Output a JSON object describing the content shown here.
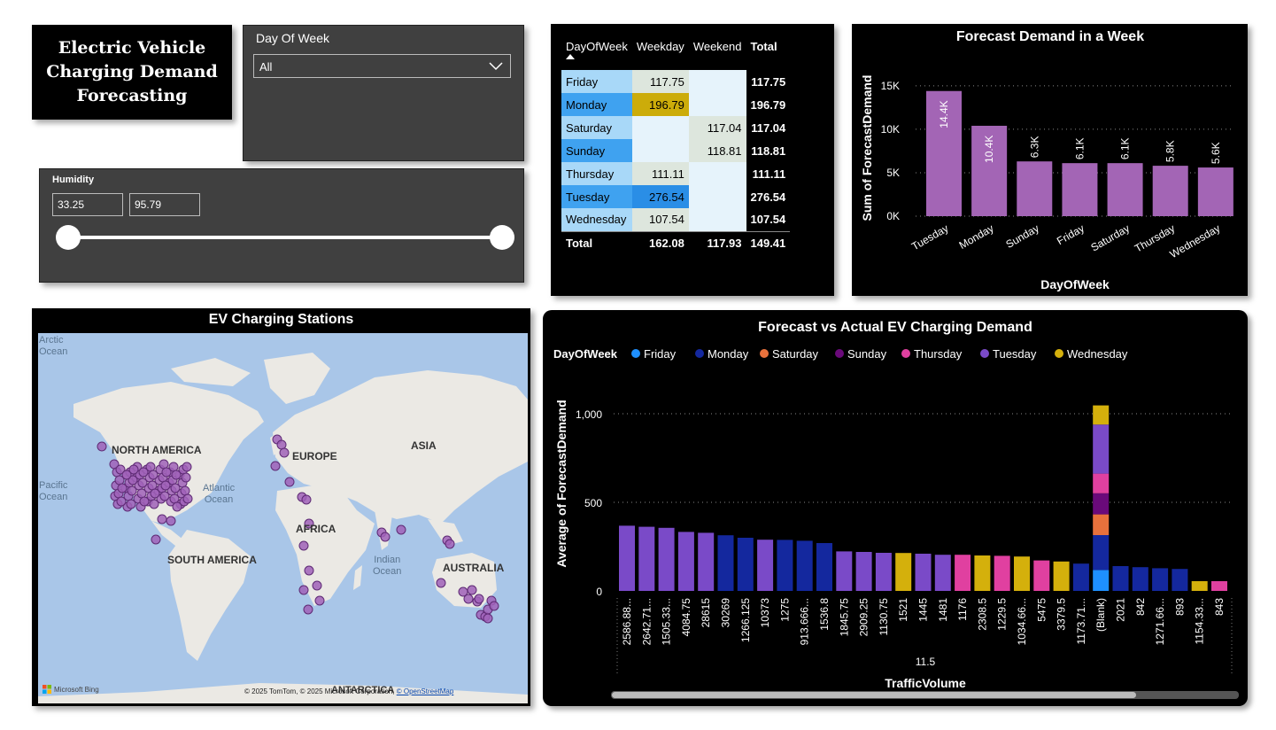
{
  "title": {
    "text": "Electric Vehicle\nCharging Demand\nForecasting"
  },
  "day_slicer": {
    "label": "Day Of Week",
    "value": "All"
  },
  "humidity_slicer": {
    "label": "Humidity",
    "min": "33.25",
    "max": "95.79"
  },
  "matrix": {
    "headers": [
      "DayOfWeek",
      "Weekday",
      "Weekend",
      "Total"
    ],
    "rows": [
      {
        "day": "Friday",
        "weekday": "117.75",
        "weekend": "",
        "total": "117.75"
      },
      {
        "day": "Monday",
        "weekday": "196.79",
        "weekend": "",
        "total": "196.79"
      },
      {
        "day": "Saturday",
        "weekday": "",
        "weekend": "117.04",
        "total": "117.04"
      },
      {
        "day": "Sunday",
        "weekday": "",
        "weekend": "118.81",
        "total": "118.81"
      },
      {
        "day": "Thursday",
        "weekday": "111.11",
        "weekend": "",
        "total": "111.11"
      },
      {
        "day": "Tuesday",
        "weekday": "276.54",
        "weekend": "",
        "total": "276.54"
      },
      {
        "day": "Wednesday",
        "weekday": "107.54",
        "weekend": "",
        "total": "107.54"
      }
    ],
    "total_row": {
      "label": "Total",
      "weekday": "162.08",
      "weekend": "117.93",
      "total": "149.41"
    },
    "colors": {
      "header_bg": "#000000",
      "day_light": "#a8d8f8",
      "day_dark": "#3fa2f0",
      "cell_bg": "#e6f3fb",
      "cell_neutral": "#dde6dd",
      "monday_gold": "#ccac0a",
      "tuesday_blue": "#2a8ee6"
    }
  },
  "chart_data": [
    {
      "type": "bar",
      "title": "Forecast Demand in a Week",
      "xlabel": "DayOfWeek",
      "ylabel": "Sum of ForecastDemand",
      "categories": [
        "Tuesday",
        "Monday",
        "Sunday",
        "Friday",
        "Saturday",
        "Thursday",
        "Wednesday"
      ],
      "values": [
        14400,
        10400,
        6300,
        6100,
        6100,
        5800,
        5600
      ],
      "data_labels": [
        "14.4K",
        "10.4K",
        "6.3K",
        "6.1K",
        "6.1K",
        "5.8K",
        "5.6K"
      ],
      "yticks": [
        "0K",
        "5K",
        "10K",
        "15K"
      ],
      "ytick_values": [
        0,
        5000,
        10000,
        15000
      ],
      "ylim": [
        0,
        15800
      ],
      "grid": true,
      "color": "#a365b5"
    },
    {
      "type": "bar",
      "title": "Forecast vs Actual EV Charging Demand",
      "xlabel": "TrafficVolume",
      "ylabel": "Average of ForecastDemand",
      "group_label": "11.5",
      "legend_title": "DayOfWeek",
      "legend_position": "top-left",
      "series_legend": [
        {
          "name": "Friday",
          "color": "#1e90ff"
        },
        {
          "name": "Monday",
          "color": "#14289e"
        },
        {
          "name": "Saturday",
          "color": "#e8713c"
        },
        {
          "name": "Sunday",
          "color": "#6a0a7a"
        },
        {
          "name": "Thursday",
          "color": "#e040a0"
        },
        {
          "name": "Tuesday",
          "color": "#7a4ac8"
        },
        {
          "name": "Wednesday",
          "color": "#d4b00c"
        }
      ],
      "yticks": [
        "0",
        "500",
        "1,000"
      ],
      "ytick_values": [
        0,
        500,
        1000
      ],
      "ylim": [
        0,
        1050
      ],
      "grid": true,
      "categories": [
        "2586.88...",
        "2642.71...",
        "1505.33...",
        "4084.75",
        "28615",
        "30269",
        "1266.125",
        "10373",
        "1275",
        "913.666...",
        "1536.8",
        "1845.75",
        "2909.25",
        "1130.75",
        "1521",
        "1445",
        "1481",
        "1176",
        "2308.5",
        "1229.5",
        "1034.66...",
        "5475",
        "3379.5",
        "1173.71...",
        "(Blank)",
        "2021",
        "842",
        "1271.66...",
        "893",
        "1154.33...",
        "843"
      ],
      "points": [
        {
          "value": 368,
          "series": "Tuesday"
        },
        {
          "value": 362,
          "series": "Tuesday"
        },
        {
          "value": 356,
          "series": "Tuesday"
        },
        {
          "value": 333,
          "series": "Tuesday"
        },
        {
          "value": 328,
          "series": "Tuesday"
        },
        {
          "value": 314,
          "series": "Monday"
        },
        {
          "value": 300,
          "series": "Monday"
        },
        {
          "value": 289,
          "series": "Tuesday"
        },
        {
          "value": 288,
          "series": "Monday"
        },
        {
          "value": 283,
          "series": "Monday"
        },
        {
          "value": 270,
          "series": "Monday"
        },
        {
          "value": 223,
          "series": "Tuesday"
        },
        {
          "value": 220,
          "series": "Tuesday"
        },
        {
          "value": 215,
          "series": "Tuesday"
        },
        {
          "value": 214,
          "series": "Wednesday"
        },
        {
          "value": 210,
          "series": "Tuesday"
        },
        {
          "value": 204,
          "series": "Tuesday"
        },
        {
          "value": 204,
          "series": "Thursday"
        },
        {
          "value": 200,
          "series": "Wednesday"
        },
        {
          "value": 198,
          "series": "Thursday"
        },
        {
          "value": 194,
          "series": "Wednesday"
        },
        {
          "value": 172,
          "series": "Thursday"
        },
        {
          "value": 166,
          "series": "Wednesday"
        },
        {
          "value": 154,
          "series": "Monday"
        },
        {
          "stack": [
            {
              "series": "Friday",
              "value": 118
            },
            {
              "series": "Monday",
              "value": 197
            },
            {
              "series": "Saturday",
              "value": 117
            },
            {
              "series": "Sunday",
              "value": 119
            },
            {
              "series": "Thursday",
              "value": 111
            },
            {
              "series": "Tuesday",
              "value": 277
            },
            {
              "series": "Wednesday",
              "value": 108
            }
          ]
        },
        {
          "value": 140,
          "series": "Monday"
        },
        {
          "value": 134,
          "series": "Monday"
        },
        {
          "value": 128,
          "series": "Monday"
        },
        {
          "value": 124,
          "series": "Monday"
        },
        {
          "value": 55,
          "series": "Wednesday"
        },
        {
          "value": 55,
          "series": "Thursday"
        }
      ]
    }
  ],
  "map": {
    "title": "EV Charging Stations",
    "labels": {
      "arctic": "Arctic\nOcean",
      "north_america": "NORTH AMERICA",
      "europe": "EUROPE",
      "asia": "ASIA",
      "pacific": "Pacific\nOcean",
      "atlantic": "Atlantic\nOcean",
      "africa": "AFRICA",
      "south_america": "SOUTH AMERICA",
      "indian": "Indian\nOcean",
      "australia": "AUSTRALIA",
      "antarctica": "ANTARCTICA"
    },
    "attribution": "© 2025 TomTom, © 2025 Microsoft Corporation,",
    "osm_link": "© OpenStreetMap",
    "bing": "Microsoft Bing",
    "colors": {
      "ocean": "#a9c6e8",
      "land": "#ebe9e4",
      "marker": "#a062b8"
    }
  }
}
